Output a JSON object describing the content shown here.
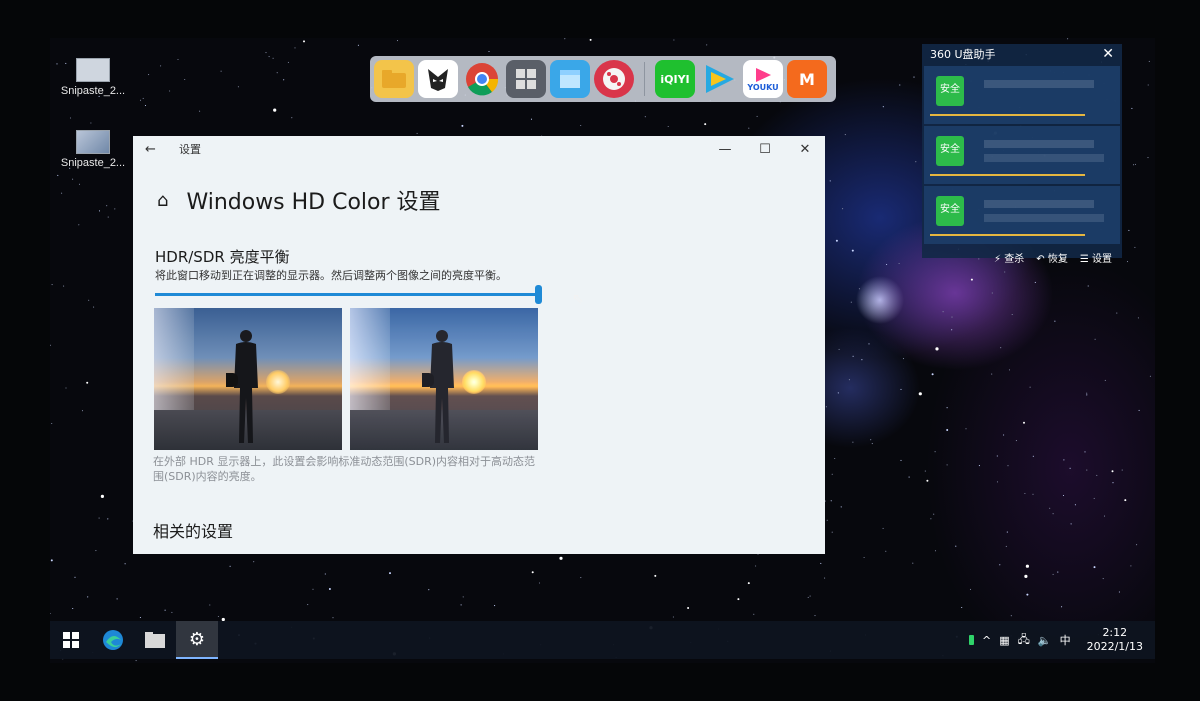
{
  "desktop": {
    "icons": [
      {
        "label": "Snipaste_2..."
      },
      {
        "label": "Snipaste_2..."
      }
    ]
  },
  "dock": {
    "apps": [
      "folder-icon",
      "foxmail-icon",
      "chrome-icon",
      "windows-store-icon",
      "package-icon",
      "media-player-icon",
      "iqiyi-icon",
      "tencent-video-icon",
      "youku-icon",
      "mango-tv-icon"
    ],
    "labels": {
      "iqiyi": "iQIYI",
      "youku": "YOUKU",
      "mango": "M"
    }
  },
  "panel360": {
    "title": "360 U盘助手",
    "close": "✕",
    "items": [
      {
        "status": "安全"
      },
      {
        "status": "安全"
      },
      {
        "status": "安全"
      }
    ],
    "footer": {
      "kill": "查杀",
      "restore": "恢复",
      "settings": "设置"
    }
  },
  "window": {
    "titlebar_label": "设置",
    "title": "Windows HD Color 设置",
    "section_title": "HDR/SDR 亮度平衡",
    "section_desc": "将此窗口移动到正在调整的显示器。然后调整两个图像之间的亮度平衡。",
    "slider_value": 1.0,
    "note": "在外部 HDR 显示器上，此设置会影响标准动态范围(SDR)内容相对于高动态范围(SDR)内容的亮度。",
    "related": "相关的设置"
  },
  "taskbar": {
    "time": "2:12",
    "date": "2022/1/13",
    "ime": "中"
  },
  "colors": {
    "accent": "#1f8ad6",
    "safe_green": "#2dbb4a",
    "progress": "#e5b640"
  }
}
